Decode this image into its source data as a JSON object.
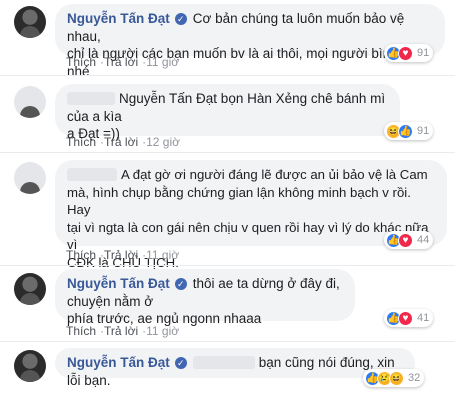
{
  "comments": [
    {
      "author": "Nguyễn Tấn Đạt",
      "verified": true,
      "lines": [
        "Cơ bản chúng ta luôn muốn bảo vệ nhau,",
        "chỉ là người các bạn muốn bv là ai thôi, mọi người bình tĩnh nhé"
      ],
      "reaction_count": "91",
      "actions": {
        "like": "Thích",
        "reply": "Trả lời",
        "time": "11 giờ"
      }
    },
    {
      "author": "",
      "lines": [
        "Nguyễn Tấn Đạt bọn Hàn Xẻng chê bánh mì của a kìa",
        "a Đạt =))"
      ],
      "reaction_count": "91",
      "actions": {
        "like": "Thích",
        "reply": "Trả lời",
        "time": "12 giờ"
      }
    },
    {
      "author": "",
      "lines": [
        "A đạt gờ ơi người đáng lẽ được an ủi bảo vệ là Cam",
        "mà, hình chụp bằng chứng gian lận không minh bạch v rồi. Hay",
        "tại vì ngta là con gái nên chịu v quen rồi hay vì lý do khác nữa vì",
        "CĐK là CHỦ TỊCH."
      ],
      "reaction_count": "44",
      "actions": {
        "like": "Thích",
        "reply": "Trả lời",
        "time": "11 giờ"
      }
    },
    {
      "author": "Nguyễn Tấn Đạt",
      "verified": true,
      "lines": [
        "thôi ae ta dừng ở đây đi, chuyện nằm ở",
        "phía trước, ae ngủ ngonn nhaaa"
      ],
      "reaction_count": "41",
      "actions": {
        "like": "Thích",
        "reply": "Trả lời",
        "time": "11 giờ"
      }
    },
    {
      "author": "Nguyễn Tấn Đạt",
      "verified": true,
      "lines": [
        "bạn cũng nói đúng, xin lỗi bạn."
      ],
      "reaction_count": "32",
      "actions": {}
    }
  ],
  "colors": {
    "author": "#385898",
    "bubble": "#f2f3f5",
    "like": "#2e7bf6",
    "love": "#f0284a",
    "haha": "#f7b125"
  }
}
